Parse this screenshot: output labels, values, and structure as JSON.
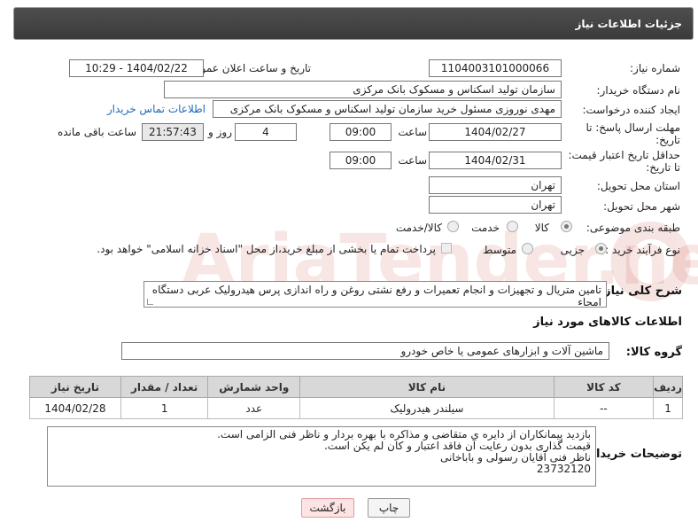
{
  "header": {
    "title": "جزئیات اطلاعات نیاز"
  },
  "fields": {
    "need_number_label": "شماره نیاز:",
    "need_number": "1104003101000066",
    "announce_label": "تاریخ و ساعت اعلان عمومی:",
    "announce_value": "1404/02/22 - 10:29",
    "buyer_org_label": "نام دستگاه خریدار:",
    "buyer_org": "سازمان تولید اسکناس و مسکوک بانک مرکزی",
    "creator_label": "ایجاد کننده درخواست:",
    "creator": "مهدی نوروزی مسئول خرید سازمان تولید اسکناس و مسکوک بانک مرکزی",
    "contact_link": "اطلاعات تماس خریدار",
    "deadline_label_1": "مهلت ارسال پاسخ: تا",
    "deadline_label_2": "تاریخ:",
    "deadline_date": "1404/02/27",
    "time_label": "ساعت",
    "deadline_time": "09:00",
    "days_value": "4",
    "days_label": "روز و",
    "remaining_time": "21:57:43",
    "remaining_label": "ساعت باقی مانده",
    "validity_label_1": "حداقل تاریخ اعتبار قیمت:",
    "validity_label_2": "تا تاریخ:",
    "validity_date": "1404/02/31",
    "validity_time": "09:00",
    "province_label": "استان محل تحویل:",
    "province": "تهران",
    "city_label": "شهر محل تحویل:",
    "city": "تهران",
    "category_label": "طبقه بندی موضوعی:",
    "category_options": [
      "کالا",
      "خدمت",
      "کالا/خدمت"
    ],
    "category_selected": "کالا",
    "process_label": "نوع فرآیند خرید :",
    "process_options": [
      "جزیی",
      "متوسط"
    ],
    "process_selected": "جزیی",
    "payment_note": "پرداخت تمام یا بخشی از مبلغ خرید،از محل \"اسناد خزانه اسلامی\" خواهد بود."
  },
  "description": {
    "label": "شرح کلی نیاز:",
    "text": "تامین متریال و تجهیزات و انجام تعمیرات و رفع نشتی روغن و راه اندازی پرس هیدرولیک عربی دستگاه امحاء"
  },
  "goods": {
    "section_title": "اطلاعات کالاهای مورد نیاز",
    "group_label": "گروه کالا:",
    "group_value": "ماشین آلات و ابزارهای عمومی یا خاص خودرو",
    "table": {
      "headers": [
        "ردیف",
        "کد کالا",
        "نام کالا",
        "واحد شمارش",
        "تعداد / مقدار",
        "تاریخ نیاز"
      ],
      "rows": [
        [
          "1",
          "--",
          "سیلندر هیدرولیک",
          "عدد",
          "1",
          "1404/02/28"
        ]
      ]
    }
  },
  "notes": {
    "label": "توضیحات خریدار:",
    "lines": [
      "بازدید پیمانکاران از دایره ی متقاضی و مذاکره با بهره بردار و ناظر فنی الزامی است.",
      "قیمت گذاری بدون رعایت آن فاقد اعتبار و کان لم یکن است.",
      "ناظر فنی آقایان رسولی و باباخانی",
      "23732120"
    ]
  },
  "buttons": {
    "print": "چاپ",
    "back": "بازگشت"
  },
  "watermark": {
    "text": "AriaTender.net"
  },
  "colors": {
    "header_bg": "#444444",
    "link": "#1c6bb8",
    "back_button_bg": "#fde3e3",
    "table_header_bg": "#d8d8d8"
  }
}
